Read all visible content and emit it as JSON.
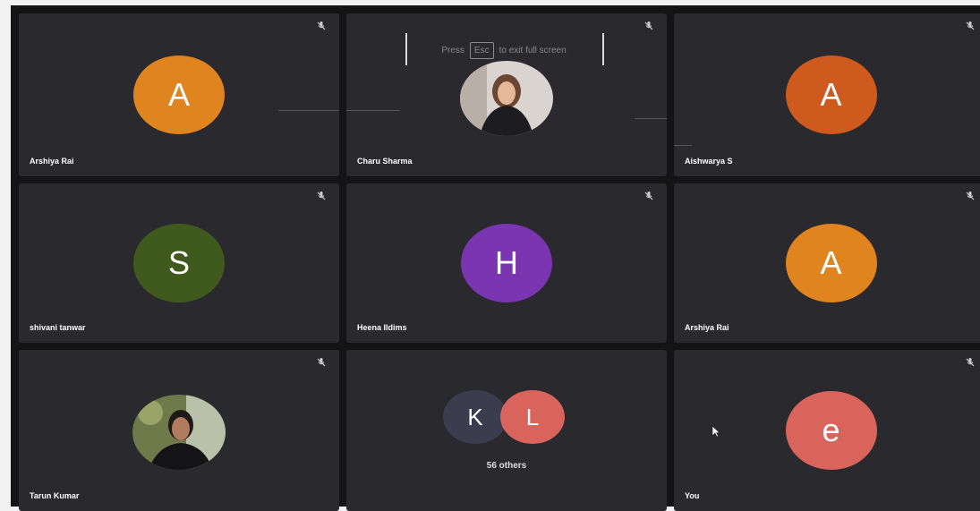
{
  "fullscreen_hint": {
    "press": "Press",
    "key": "Esc",
    "suffix": "to exit full screen"
  },
  "tiles": [
    {
      "name": "Arshiya Rai",
      "avatar_letter": "A",
      "avatar_color": "#e0841f",
      "muted": true
    },
    {
      "name": "Charu Sharma",
      "avatar_letter": "",
      "avatar_color": "",
      "muted": true
    },
    {
      "name": "Aishwarya S",
      "avatar_letter": "A",
      "avatar_color": "#cf5a1e",
      "muted": true
    },
    {
      "name": "shivani tanwar",
      "avatar_letter": "S",
      "avatar_color": "#3f5a1c",
      "muted": true
    },
    {
      "name": "Heena Ildims",
      "avatar_letter": "H",
      "avatar_color": "#7a35b0",
      "muted": true
    },
    {
      "name": "Arshiya Rai",
      "avatar_letter": "A",
      "avatar_color": "#e0841f",
      "muted": true
    },
    {
      "name": "Tarun Kumar",
      "avatar_letter": "",
      "avatar_color": "",
      "muted": true
    },
    {
      "name": "",
      "avatar_letter": "",
      "avatar_color": "",
      "muted": false
    },
    {
      "name": "You",
      "avatar_letter": "e",
      "avatar_color": "#d9645c",
      "muted": true
    }
  ],
  "others": {
    "avatars": [
      {
        "letter": "K",
        "color": "#3b3d4f"
      },
      {
        "letter": "L",
        "color": "#d9645c"
      }
    ],
    "label": "56 others"
  }
}
